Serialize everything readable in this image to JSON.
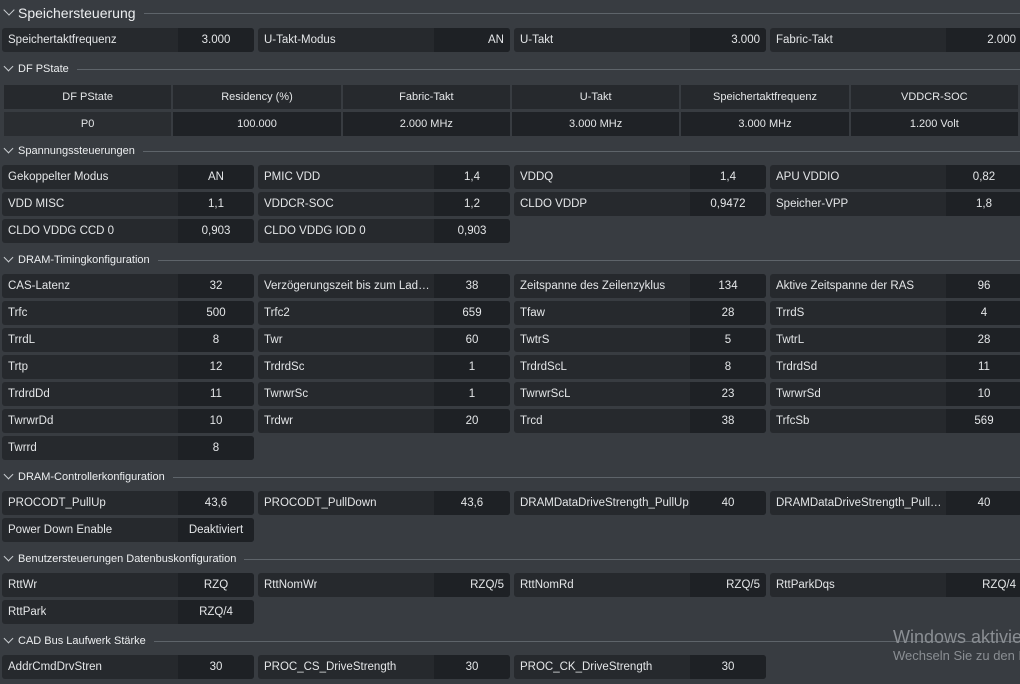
{
  "header": {
    "title": "Speichersteuerung"
  },
  "top_row": [
    {
      "label": "Speichertaktfrequenz",
      "value": "3.000"
    },
    {
      "label": "U-Takt-Modus",
      "value": "AN",
      "right": true
    },
    {
      "label": "U-Takt",
      "value": "3.000",
      "right": true
    },
    {
      "label": "Fabric-Takt",
      "value": "2.000",
      "right": true
    }
  ],
  "df_pstate": {
    "title": "DF PState",
    "columns": [
      "DF PState",
      "Residency (%)",
      "Fabric-Takt",
      "U-Takt",
      "Speichertaktfrequenz",
      "VDDCR-SOC"
    ],
    "row": [
      "P0",
      "100.000",
      "2.000 MHz",
      "3.000 MHz",
      "3.000 MHz",
      "1.200 Volt"
    ]
  },
  "sections": [
    {
      "title": "Spannungssteuerungen",
      "rows": [
        [
          {
            "label": "Gekoppelter Modus",
            "value": "AN"
          },
          {
            "label": "PMIC VDD",
            "value": "1,4"
          },
          {
            "label": "VDDQ",
            "value": "1,4"
          },
          {
            "label": "APU VDDIO",
            "value": "0,82"
          }
        ],
        [
          {
            "label": "VDD MISC",
            "value": "1,1"
          },
          {
            "label": "VDDCR-SOC",
            "value": "1,2"
          },
          {
            "label": "CLDO VDDP",
            "value": "0,9472"
          },
          {
            "label": "Speicher-VPP",
            "value": "1,8"
          }
        ],
        [
          {
            "label": "CLDO VDDG CCD 0",
            "value": "0,903"
          },
          {
            "label": "CLDO VDDG IOD 0",
            "value": "0,903"
          }
        ]
      ]
    },
    {
      "title": "DRAM-Timingkonfiguration",
      "rows": [
        [
          {
            "label": "CAS-Latenz",
            "value": "32"
          },
          {
            "label": "Verzögerungszeit bis zum Laden ...",
            "value": "38"
          },
          {
            "label": "Zeitspanne des Zeilenzyklus",
            "value": "134"
          },
          {
            "label": "Aktive Zeitspanne der RAS",
            "value": "96"
          }
        ],
        [
          {
            "label": "Trfc",
            "value": "500"
          },
          {
            "label": "Trfc2",
            "value": "659"
          },
          {
            "label": "Tfaw",
            "value": "28"
          },
          {
            "label": "TrrdS",
            "value": "4"
          }
        ],
        [
          {
            "label": "TrrdL",
            "value": "8"
          },
          {
            "label": "Twr",
            "value": "60"
          },
          {
            "label": "TwtrS",
            "value": "5"
          },
          {
            "label": "TwtrL",
            "value": "28"
          }
        ],
        [
          {
            "label": "Trtp",
            "value": "12"
          },
          {
            "label": "TrdrdSc",
            "value": "1"
          },
          {
            "label": "TrdrdScL",
            "value": "8"
          },
          {
            "label": "TrdrdSd",
            "value": "11"
          }
        ],
        [
          {
            "label": "TrdrdDd",
            "value": "11"
          },
          {
            "label": "TwrwrSc",
            "value": "1"
          },
          {
            "label": "TwrwrScL",
            "value": "23"
          },
          {
            "label": "TwrwrSd",
            "value": "10"
          }
        ],
        [
          {
            "label": "TwrwrDd",
            "value": "10"
          },
          {
            "label": "Trdwr",
            "value": "20"
          },
          {
            "label": "Trcd",
            "value": "38"
          },
          {
            "label": "TrfcSb",
            "value": "569"
          }
        ],
        [
          {
            "label": "Twrrd",
            "value": "8"
          }
        ]
      ]
    },
    {
      "title": "DRAM-Controllerkonfiguration",
      "rows": [
        [
          {
            "label": "PROCODT_PullUp",
            "value": "43,6"
          },
          {
            "label": "PROCODT_PullDown",
            "value": "43,6"
          },
          {
            "label": "DRAMDataDriveStrength_PullUp",
            "value": "40"
          },
          {
            "label": "DRAMDataDriveStrength_PullDo...",
            "value": "40"
          }
        ],
        [
          {
            "label": "Power Down Enable",
            "value": "Deaktiviert"
          }
        ]
      ]
    },
    {
      "title": "Benutzersteuerungen Datenbuskonfiguration",
      "rows": [
        [
          {
            "label": "RttWr",
            "value": "RZQ"
          },
          {
            "label": "RttNomWr",
            "value": "RZQ/5",
            "right": true
          },
          {
            "label": "RttNomRd",
            "value": "RZQ/5",
            "right": true
          },
          {
            "label": "RttParkDqs",
            "value": "RZQ/4",
            "right": true
          }
        ],
        [
          {
            "label": "RttPark",
            "value": "RZQ/4"
          }
        ]
      ]
    },
    {
      "title": "CAD Bus Laufwerk Stärke",
      "rows": [
        [
          {
            "label": "AddrCmdDrvStren",
            "value": "30"
          },
          {
            "label": "PROC_CS_DriveStrength",
            "value": "30"
          },
          {
            "label": "PROC_CK_DriveStrength",
            "value": "30"
          }
        ]
      ]
    }
  ],
  "watermark": {
    "line1": "Windows aktivieren",
    "line2": "Wechseln Sie zu den Einstellungen"
  }
}
